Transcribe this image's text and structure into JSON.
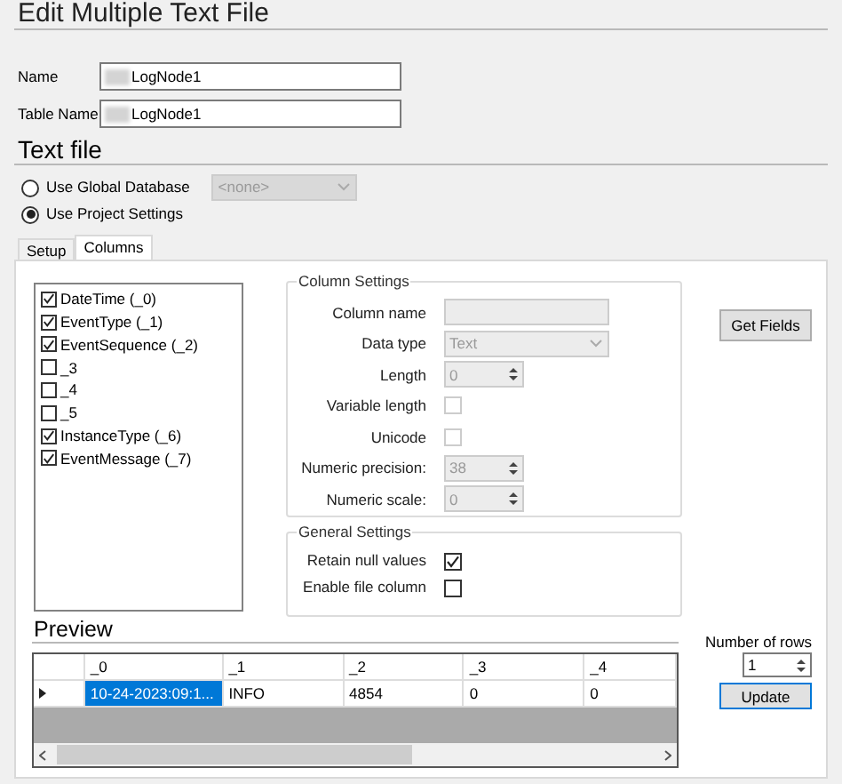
{
  "title": "Edit Multiple Text File",
  "fields": [
    {
      "label": "Name",
      "value": "LogNode1"
    },
    {
      "label": "Table Name",
      "value": "LogNode1"
    }
  ],
  "text_file": {
    "heading": "Text file",
    "options": [
      {
        "label": "Use Global Database",
        "selected": false
      },
      {
        "label": "Use Project Settings",
        "selected": true
      }
    ],
    "database_select": {
      "value": "<none>",
      "disabled": true
    }
  },
  "tabs": [
    {
      "label": "Setup",
      "selected": false
    },
    {
      "label": "Columns",
      "selected": true
    }
  ],
  "columns_list": [
    {
      "label": "DateTime (_0)",
      "checked": true
    },
    {
      "label": "EventType (_1)",
      "checked": true
    },
    {
      "label": "EventSequence (_2)",
      "checked": true
    },
    {
      "label": "_3",
      "checked": false
    },
    {
      "label": "_4",
      "checked": false
    },
    {
      "label": "_5",
      "checked": false
    },
    {
      "label": "InstanceType (_6)",
      "checked": true
    },
    {
      "label": "EventMessage (_7)",
      "checked": true
    }
  ],
  "column_settings": {
    "title": "Column Settings",
    "disabled": true,
    "rows": [
      {
        "kind": "text",
        "label": "Column name"
      },
      {
        "kind": "select",
        "label": "Data type",
        "value": "Text"
      },
      {
        "kind": "spin",
        "label": "Length",
        "value": "0"
      },
      {
        "kind": "check",
        "label": "Variable length",
        "checked": false
      },
      {
        "kind": "check",
        "label": "Unicode",
        "checked": false
      },
      {
        "kind": "spin",
        "label": "Numeric precision:",
        "value": "38"
      },
      {
        "kind": "spin",
        "label": "Numeric scale:",
        "value": "0"
      }
    ]
  },
  "general_settings": {
    "title": "General Settings",
    "rows": [
      {
        "label": "Retain null values",
        "checked": true
      },
      {
        "label": "Enable file column",
        "checked": false
      }
    ]
  },
  "get_fields_button": "Get Fields",
  "preview": {
    "heading": "Preview",
    "columns": [
      "_0",
      "_1",
      "_2",
      "_3",
      "_4"
    ],
    "rows": [
      {
        "current": true,
        "cells": [
          {
            "text": "10-24-2023:09:1...",
            "selected": true
          },
          {
            "text": "INFO",
            "selected": false
          },
          {
            "text": "4854",
            "selected": false
          },
          {
            "text": "0",
            "selected": false
          },
          {
            "text": "0",
            "selected": false
          }
        ]
      }
    ]
  },
  "number_of_rows": {
    "label": "Number of rows",
    "value": "1"
  },
  "update_button": "Update"
}
